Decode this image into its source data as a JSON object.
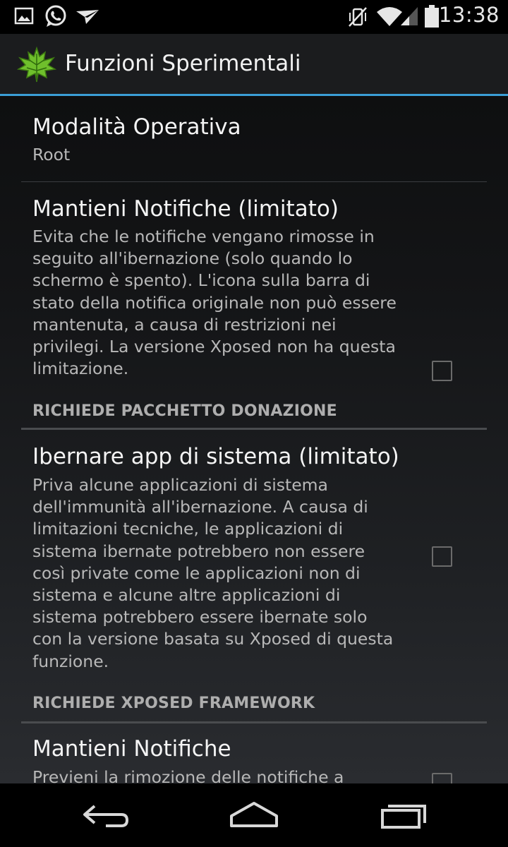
{
  "status_bar": {
    "time": "13:38",
    "left_icons": [
      "gallery-icon",
      "whatsapp-icon",
      "send-icon"
    ],
    "right_icons": [
      "vibrate-mute-icon",
      "wifi-icon",
      "signal-icon",
      "battery-icon"
    ]
  },
  "action_bar": {
    "title": "Funzioni Sperimentali",
    "icon": "maple-leaf-icon",
    "accent_color": "#3b9ed6"
  },
  "preferences": {
    "mode": {
      "title": "Modalità Operativa",
      "summary": "Root"
    },
    "keep_notifications_limited": {
      "title": "Mantieni Notifiche (limitato)",
      "summary_lines": [
        "Evita che le notifiche vengano rimosse in",
        "seguito all'ibernazione (solo quando lo",
        "schermo è spento). L'icona sulla barra di",
        "stato della notifica originale non può essere",
        "mantenuta, a causa di restrizioni nei",
        "privilegi. La versione Xposed non ha questa",
        "limitazione."
      ],
      "checked": false
    },
    "category_donation": "RICHIEDE PACCHETTO DONAZIONE",
    "hibernate_system_apps": {
      "title": "Ibernare app di sistema (limitato)",
      "summary_lines": [
        "Priva alcune applicazioni di sistema",
        "dell'immunità all'ibernazione. A causa di",
        "limitazioni tecniche, le applicazioni di",
        "sistema ibernate potrebbero non essere",
        "così private come le applicazioni non di",
        "sistema e alcune altre applicazioni di",
        "sistema potrebbero essere ibernate solo",
        "con la versione basata su Xposed di questa",
        "funzione."
      ],
      "checked": false
    },
    "category_xposed": "RICHIEDE XPOSED FRAMEWORK",
    "keep_notifications": {
      "title": "Mantieni Notifiche",
      "summary_first_line": "Previeni la rimozione delle notifiche a",
      "checked": false
    }
  },
  "nav_bar": {
    "buttons": [
      "back-icon",
      "home-icon",
      "recents-icon"
    ]
  }
}
